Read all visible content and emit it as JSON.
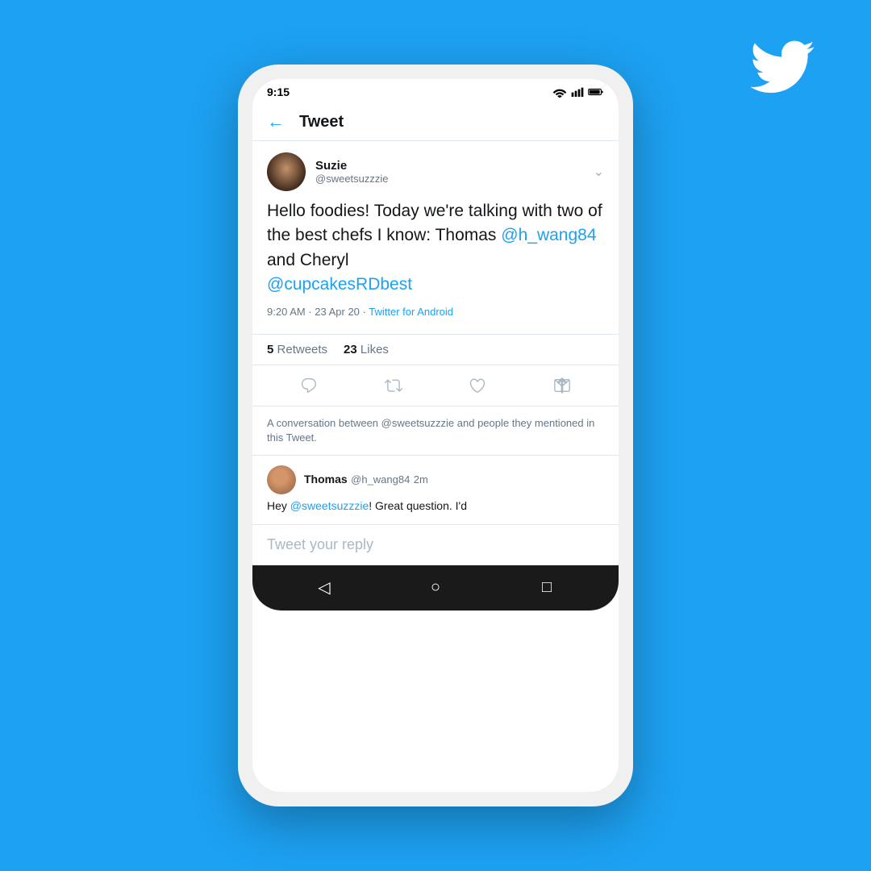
{
  "background_color": "#1DA1F2",
  "header": {
    "back_label": "←",
    "title": "Tweet"
  },
  "status_bar": {
    "time": "9:15"
  },
  "tweet": {
    "author": {
      "name": "Suzie",
      "handle": "@sweetsuzzzie"
    },
    "body_part1": "Hello foodies! Today we're talking with two of the best chefs I know: Thomas ",
    "mention1": "@h_wang84",
    "body_part2": " and Cheryl ",
    "mention2": "@cupcakesRDbest",
    "meta": "9:20 AM · 23 Apr 20 · ",
    "source": "Twitter for Android",
    "retweets_count": "5",
    "retweets_label": "Retweets",
    "likes_count": "23",
    "likes_label": "Likes"
  },
  "conversation_note": {
    "text": "A conversation between @sweetsuzzzie and people they mentioned in this Tweet."
  },
  "reply": {
    "author_name": "Thomas",
    "author_handle": "@h_wang84",
    "time": "2m",
    "body_part1": "Hey ",
    "mention": "@sweetsuzzzie",
    "body_part2": "! Great question. I'd"
  },
  "reply_input": {
    "placeholder": "Tweet your reply"
  },
  "bottom_nav": {
    "back_icon": "◁",
    "home_icon": "○",
    "recents_icon": "□"
  }
}
